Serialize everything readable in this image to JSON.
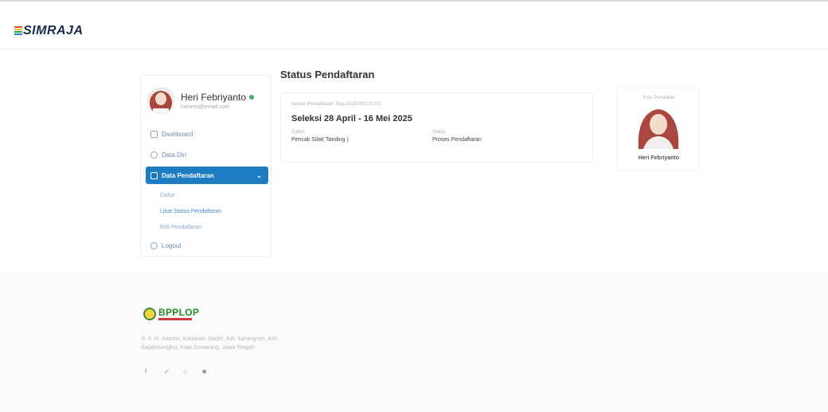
{
  "app": {
    "brand": "SIMRAJA",
    "brand_colors": [
      "#e84c3d",
      "#f2c12e",
      "#2fa65a",
      "#2b7bd1"
    ]
  },
  "user": {
    "name": "Heri Febriyanto",
    "email": "heriexs@email.com",
    "status": "online"
  },
  "sidebar": {
    "items": [
      {
        "label": "Dashboard",
        "icon": "dashboard-icon"
      },
      {
        "label": "Data Diri",
        "icon": "user-icon"
      },
      {
        "label": "Data Pendaftaran",
        "icon": "home-icon",
        "active": true
      }
    ],
    "submenu": [
      {
        "label": "Daftar"
      },
      {
        "label": "Lihat Status Pendaftaran",
        "current": true
      },
      {
        "label": "Edit Pendaftaran"
      }
    ],
    "logout_label": "Logout"
  },
  "main": {
    "title": "Status Pendaftaran",
    "card": {
      "registration_no": "Nomor Pendaftaran: Reg-2025/0002/1203",
      "period": "Seleksi 28 April - 16 Mei 2025",
      "cabor_label": "Cabor",
      "cabor_value": "Pencak Silat( Tanding )",
      "status_label": "Status",
      "status_value": "Proses Pendaftaran"
    },
    "photo_card": {
      "caption": "Foto Pendaftar",
      "name": "Heri Febriyanto"
    }
  },
  "footer": {
    "logo_text": "BPPLOP",
    "address": "Jl. Ir. H. Juanda, Kawasan Jatidiri, Kel. Karangrejo, Kec. Gajahmungkur, Kota Semarang, Jawa Tengah",
    "socials": [
      "f",
      "✓",
      "○",
      "■"
    ]
  }
}
